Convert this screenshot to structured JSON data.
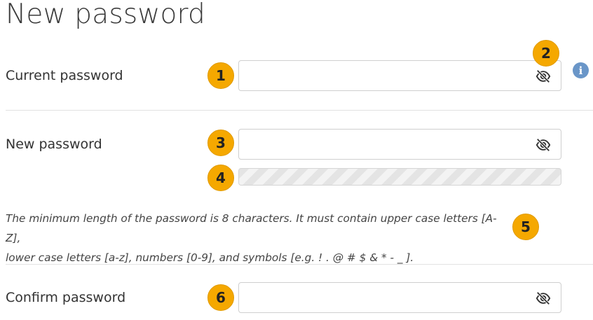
{
  "page": {
    "title": "New password"
  },
  "fields": {
    "current": {
      "label": "Current password",
      "value": ""
    },
    "new": {
      "label": "New password",
      "value": ""
    },
    "confirm": {
      "label": "Confirm password",
      "value": ""
    }
  },
  "strength_meter": {
    "level": 0
  },
  "hint": {
    "line1": "The minimum length of the password is 8 characters. It must contain upper case letters [A-Z],",
    "line2": "lower case letters [a-z], numbers [0-9], and symbols [e.g. ! . @ # $ & * - _ ]."
  },
  "callouts": [
    "1",
    "2",
    "3",
    "4",
    "5",
    "6"
  ],
  "icons": {
    "eye": "eye-slash-icon",
    "info": "info-icon",
    "info_glyph": "i"
  },
  "colors": {
    "callout": "#f5a800",
    "info": "#6a96c8"
  }
}
